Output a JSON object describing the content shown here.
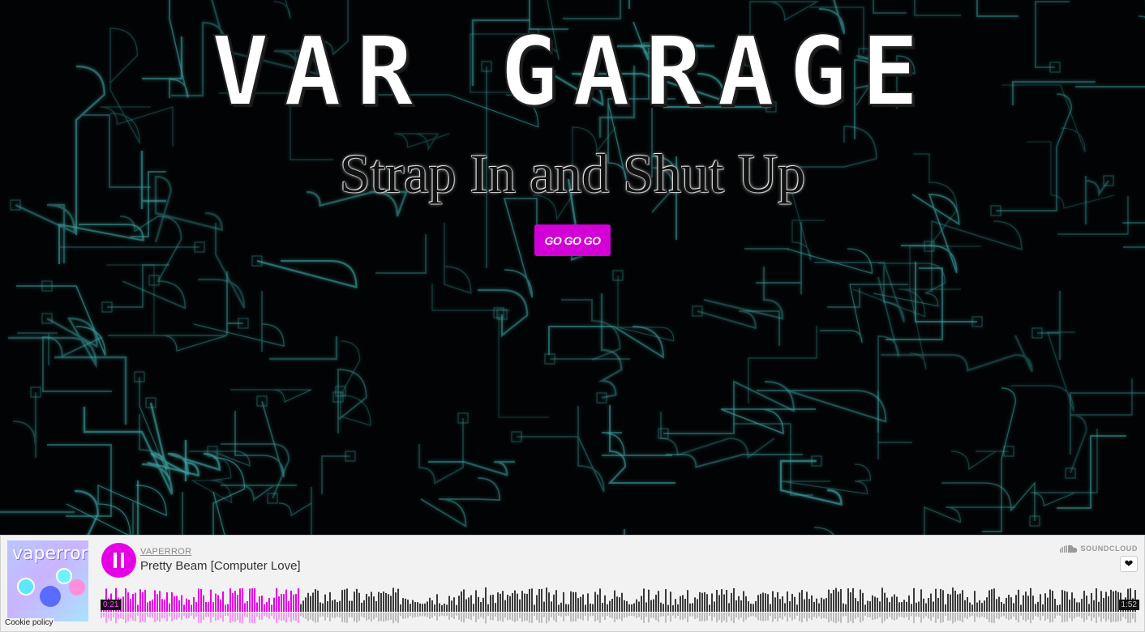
{
  "hero": {
    "logo_text": "VAR GARAGE",
    "tagline": "Strap In and Shut Up",
    "cta_label": "GO GO GO"
  },
  "player": {
    "artwork_text": "vaperror",
    "artist": "VAPERROR",
    "track": "Pretty Beam [Computer Love]",
    "brand": "SOUNDCLOUD",
    "current_time": "0:21",
    "duration": "1:52",
    "progress": 0.19,
    "state_icon": "pause-icon",
    "like_icon": "heart-icon"
  },
  "footer": {
    "cookie_policy": "Cookie policy"
  },
  "colors": {
    "accent": "#e600e6",
    "background": "#020304",
    "circuit": "#3fa7a7",
    "player_bg": "#f2f2f2"
  }
}
